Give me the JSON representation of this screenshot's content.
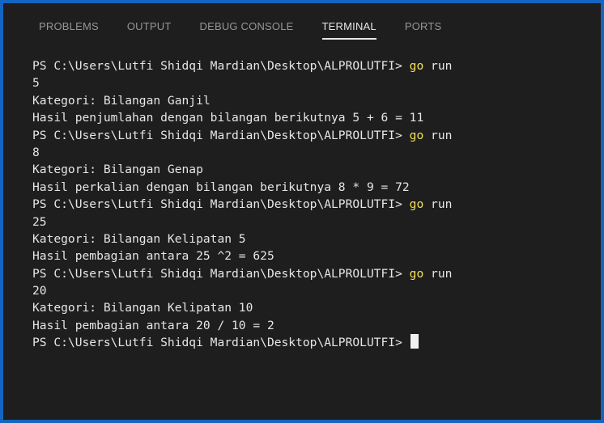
{
  "tabs": [
    {
      "label": "PROBLEMS",
      "active": false
    },
    {
      "label": "OUTPUT",
      "active": false
    },
    {
      "label": "DEBUG CONSOLE",
      "active": false
    },
    {
      "label": "TERMINAL",
      "active": true
    },
    {
      "label": "PORTS",
      "active": false
    }
  ],
  "terminal": {
    "prompt": "PS C:\\Users\\Lutfi Shidqi Mardian\\Desktop\\ALPROLUTFI>",
    "command_keyword": "go",
    "command_rest": "run",
    "lines": [
      {
        "type": "cmd"
      },
      {
        "type": "out",
        "text": "5"
      },
      {
        "type": "out",
        "text": "Kategori: Bilangan Ganjil"
      },
      {
        "type": "out",
        "text": "Hasil penjumlahan dengan bilangan berikutnya 5 + 6 = 11"
      },
      {
        "type": "cmd"
      },
      {
        "type": "out",
        "text": "8"
      },
      {
        "type": "out",
        "text": "Kategori: Bilangan Genap"
      },
      {
        "type": "out",
        "text": "Hasil perkalian dengan bilangan berikutnya 8 * 9 = 72"
      },
      {
        "type": "cmd"
      },
      {
        "type": "out",
        "text": "25"
      },
      {
        "type": "out",
        "text": "Kategori: Bilangan Kelipatan 5"
      },
      {
        "type": "out",
        "text": "Hasil pembagian antara 25 ^2 = 625"
      },
      {
        "type": "cmd"
      },
      {
        "type": "out",
        "text": "20"
      },
      {
        "type": "out",
        "text": "Kategori: Bilangan Kelipatan 10"
      },
      {
        "type": "out",
        "text": "Hasil pembagian antara 20 / 10 = 2"
      },
      {
        "type": "prompt_only"
      }
    ]
  }
}
